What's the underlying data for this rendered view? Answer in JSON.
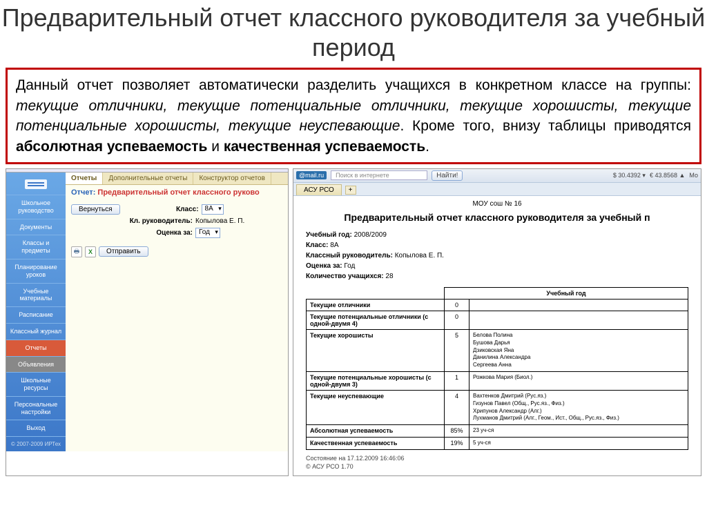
{
  "slide": {
    "title": "Предварительный отчет классного руководителя за учебный период",
    "desc_pre": "Данный отчет позволяет автоматически разделить учащихся в конкретном классе на группы: ",
    "desc_groups": "текущие отличники, текущие потенциальные отличники, текущие хорошисты, текущие потенциальные хорошисты, текущие неуспевающие",
    "desc_post1": ". Кроме того, внизу таблицы приводятся ",
    "desc_b1": "абсолютная успеваемость",
    "desc_and": " и ",
    "desc_b2": "качественная успеваемость",
    "desc_end": "."
  },
  "left": {
    "side": {
      "items": [
        "Школьное руководство",
        "Документы",
        "Классы и предметы",
        "Планирование уроков",
        "Учебные материалы",
        "Расписание",
        "Классный журнал",
        "Отчеты",
        "Объявления",
        "Школьные ресурсы",
        "Персональные настройки",
        "Выход"
      ],
      "footer": "© 2007-2009 ИРТех"
    },
    "tabs": [
      "Отчеты",
      "Дополнительные отчеты",
      "Конструктор отчетов"
    ],
    "title_label": "Отчет:",
    "title_value": "Предварительный отчет классного руково",
    "back_btn": "Вернуться",
    "fields": {
      "class_lbl": "Класс:",
      "class_val": "8А",
      "teacher_lbl": "Кл. руководитель:",
      "teacher_val": "Копылова Е. П.",
      "grade_lbl": "Оценка за:",
      "grade_val": "Год"
    },
    "send_btn": "Отправить"
  },
  "right": {
    "topbar": {
      "mail": "@mail.ru",
      "search_ph": "Поиск в интернете",
      "find": "Найти!",
      "rate1": "$ 30.4392 ▾",
      "rate2": "€ 43.8568 ▲",
      "more": "Мо"
    },
    "tab": "АСУ РСО",
    "org": "МОУ сош № 16",
    "heading": "Предварительный отчет классного руководителя за учебный п",
    "meta": {
      "year_l": "Учебный год:",
      "year_v": "2008/2009",
      "class_l": "Класс:",
      "class_v": "8А",
      "teacher_l": "Классный руководитель:",
      "teacher_v": "Копылова Е. П.",
      "grade_l": "Оценка за:",
      "grade_v": "Год",
      "count_l": "Количество учащихся:",
      "count_v": "28"
    },
    "table": {
      "head_col": "Учебный год",
      "rows": [
        {
          "label": "Текущие отличники",
          "count": "0",
          "detail": ""
        },
        {
          "label": "Текущие потенциальные отличники (с одной-двумя 4)",
          "count": "0",
          "detail": ""
        },
        {
          "label": "Текущие хорошисты",
          "count": "5",
          "detail": "Белова Полина\nБушова Дарья\nДзиковская Яна\nДанилина Александра\nСергеева Анна"
        },
        {
          "label": "Текущие потенциальные хорошисты (с одной-двумя 3)",
          "count": "1",
          "detail": "Рожкова Мария (Биол.)"
        },
        {
          "label": "Текущие неуспевающие",
          "count": "4",
          "detail": "Вахтенков Дмитрий (Рус.яз.)\nГизунов Павел (Общ., Рус.яз., Физ.)\nХрипунов Александр (Алг.)\nЛухманов Дмитрий (Алг., Геом., Ист., Общ., Рус.яз., Физ.)"
        },
        {
          "label": "Абсолютная успеваемость",
          "count": "85%",
          "detail": "23 уч-ся"
        },
        {
          "label": "Качественная успеваемость",
          "count": "19%",
          "detail": "5 уч-ся"
        }
      ]
    },
    "footer_line1": "Состояние на 17.12.2009 16:46:06",
    "footer_line2": "© АСУ РСО 1.70"
  }
}
